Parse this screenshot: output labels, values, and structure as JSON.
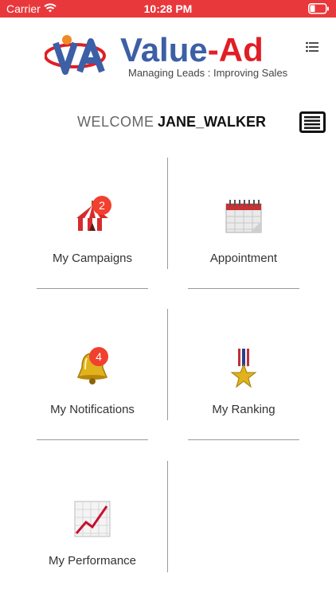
{
  "status_bar": {
    "carrier": "Carrier",
    "time": "10:28 PM",
    "icons": [
      "wifi-icon",
      "battery-icon"
    ]
  },
  "header": {
    "brand_name_left": "Value",
    "brand_name_dash": "-",
    "brand_name_right": "Ad",
    "tagline": "Managing Leads : Improving Sales",
    "menu_icon": "list-icon"
  },
  "welcome": {
    "label": "WELCOME",
    "user_name": "JANE_WALKER",
    "news_icon": "newspaper-icon"
  },
  "tiles": [
    {
      "label": "My Campaigns",
      "icon": "circus-tent-icon",
      "badge": "2"
    },
    {
      "label": "Appointment",
      "icon": "calendar-icon",
      "badge": ""
    },
    {
      "label": "My Notifications",
      "icon": "bell-icon",
      "badge": "4"
    },
    {
      "label": "My Ranking",
      "icon": "medal-icon",
      "badge": ""
    },
    {
      "label": "My Performance",
      "icon": "chart-increasing-icon",
      "badge": ""
    }
  ],
  "colors": {
    "status_bar": "#e8383b",
    "brand_blue": "#3c5fa6",
    "brand_red": "#e01e26",
    "badge": "#f2402f",
    "divider": "#9a9a9a"
  }
}
